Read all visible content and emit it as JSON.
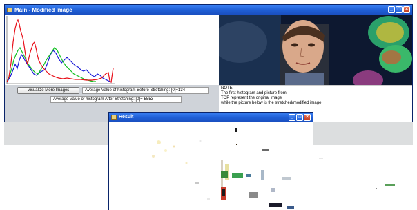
{
  "main_window": {
    "title": "Main - Modified Image",
    "hist_series": [
      {
        "name": "red",
        "color": "#e8101a"
      },
      {
        "name": "green",
        "color": "#10c020"
      },
      {
        "name": "blue",
        "color": "#1a1ad8"
      }
    ],
    "buttons": {
      "visualize": "Visualize More Images"
    },
    "labels": {
      "avg_before": "Average Value of histogram Before Stretching: [0]=134",
      "avg_after": "Average Value of histogram After Stretching: [0]=-5553"
    },
    "note": {
      "heading": "NOTE",
      "line1": "The first histogram and picture from",
      "line2": "TOP represent the original image",
      "line3": "while the picture below is the stretched/modified image"
    }
  },
  "result_window": {
    "title": "Result"
  },
  "colors": {
    "titlebar": "#1f5fd6",
    "panel_bg": "#d4d0c8",
    "close_button": "#c1391d"
  }
}
